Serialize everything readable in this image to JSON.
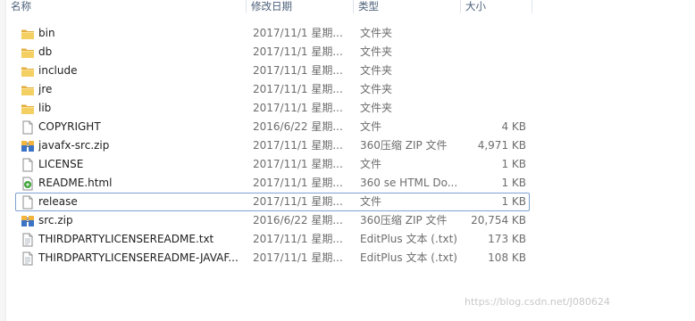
{
  "columns": {
    "name": "名称",
    "date": "修改日期",
    "type": "类型",
    "size": "大小"
  },
  "files": [
    {
      "name": "bin",
      "date": "2017/11/1 星期...",
      "type": "文件夹",
      "size": "",
      "icon": "folder-icon"
    },
    {
      "name": "db",
      "date": "2017/11/1 星期...",
      "type": "文件夹",
      "size": "",
      "icon": "folder-icon"
    },
    {
      "name": "include",
      "date": "2017/11/1 星期...",
      "type": "文件夹",
      "size": "",
      "icon": "folder-icon"
    },
    {
      "name": "jre",
      "date": "2017/11/1 星期...",
      "type": "文件夹",
      "size": "",
      "icon": "folder-icon"
    },
    {
      "name": "lib",
      "date": "2017/11/1 星期...",
      "type": "文件夹",
      "size": "",
      "icon": "folder-icon"
    },
    {
      "name": "COPYRIGHT",
      "date": "2016/6/22 星期...",
      "type": "文件",
      "size": "4 KB",
      "icon": "file-icon"
    },
    {
      "name": "javafx-src.zip",
      "date": "2017/11/1 星期...",
      "type": "360压缩 ZIP 文件",
      "size": "4,971 KB",
      "icon": "zip-icon"
    },
    {
      "name": "LICENSE",
      "date": "2017/11/1 星期...",
      "type": "文件",
      "size": "1 KB",
      "icon": "file-icon"
    },
    {
      "name": "README.html",
      "date": "2017/11/1 星期...",
      "type": "360 se HTML Do...",
      "size": "1 KB",
      "icon": "html-icon"
    },
    {
      "name": "release",
      "date": "2017/11/1 星期...",
      "type": "文件",
      "size": "1 KB",
      "icon": "file-icon",
      "selected": true
    },
    {
      "name": "src.zip",
      "date": "2016/6/22 星期...",
      "type": "360压缩 ZIP 文件",
      "size": "20,754 KB",
      "icon": "zip-icon"
    },
    {
      "name": "THIRDPARTYLICENSEREADME.txt",
      "date": "2017/11/1 星期...",
      "type": "EditPlus 文本 (.txt)",
      "size": "173 KB",
      "icon": "text-file-icon"
    },
    {
      "name": "THIRDPARTYLICENSEREADME-JAVAF...",
      "date": "2017/11/1 星期...",
      "type": "EditPlus 文本 (.txt)",
      "size": "108 KB",
      "icon": "text-file-icon"
    }
  ],
  "watermark": "https://blog.csdn.net/J080624",
  "colors": {
    "folder": "#e8b84a",
    "selection_border": "#7da2ce",
    "header_text": "#4c607a"
  }
}
